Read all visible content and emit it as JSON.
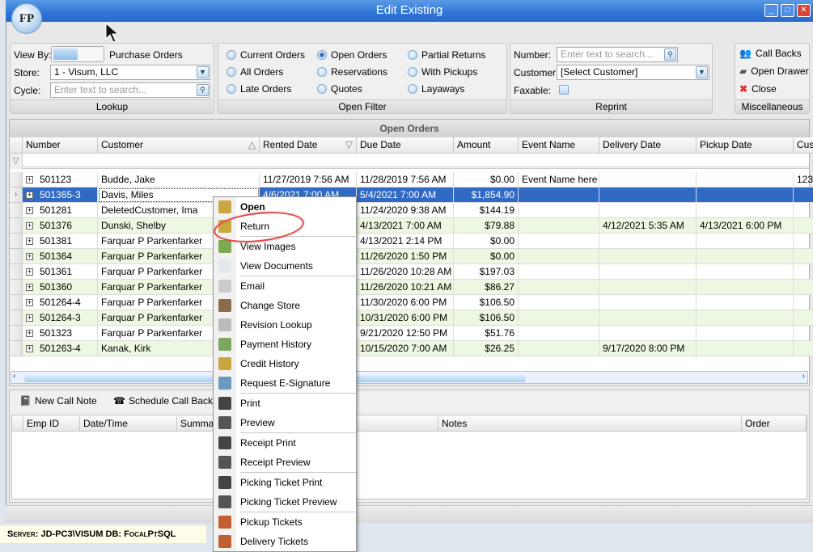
{
  "window": {
    "title": "Edit Existing",
    "logo": "FP"
  },
  "lookup": {
    "caption": "Lookup",
    "view_by_label": "View By:",
    "view_by_value": "Purchase Orders",
    "store_label": "Store:",
    "store_value": "1 - Visum, LLC",
    "cycle_label": "Cycle:",
    "cycle_placeholder": "Enter text to search..."
  },
  "open_filter": {
    "caption": "Open Filter",
    "options": [
      {
        "label": "Current Orders",
        "checked": false
      },
      {
        "label": "Open Orders",
        "checked": true
      },
      {
        "label": "Partial Returns",
        "checked": false
      },
      {
        "label": "All Orders",
        "checked": false
      },
      {
        "label": "Reservations",
        "checked": false
      },
      {
        "label": "With Pickups",
        "checked": false
      },
      {
        "label": "Late Orders",
        "checked": false
      },
      {
        "label": "Quotes",
        "checked": false
      },
      {
        "label": "Layaways",
        "checked": false
      }
    ]
  },
  "reprint": {
    "caption": "Reprint",
    "number_label": "Number:",
    "number_placeholder": "Enter text to search...",
    "customer_label": "Customer:",
    "customer_value": "[Select Customer]",
    "faxable_label": "Faxable:"
  },
  "misc": {
    "caption": "Miscellaneous",
    "call_backs": "Call Backs",
    "open_drawer": "Open Drawer",
    "close": "Close"
  },
  "grid": {
    "title": "Open Orders",
    "columns": [
      "Number",
      "Customer",
      "Rented Date",
      "Due Date",
      "Amount",
      "Event Name",
      "Delivery Date",
      "Pickup Date",
      "Cus"
    ],
    "rows": [
      [
        "501123",
        "Budde, Jake",
        "11/27/2019 7:56 AM",
        "11/28/2019 7:56 AM",
        "$0.00",
        "Event Name here",
        "",
        "",
        "123"
      ],
      [
        "501365-3",
        "Davis, Miles",
        "4/6/2021 7:00 AM",
        "5/4/2021 7:00 AM",
        "$1,854.90",
        "",
        "",
        "",
        ""
      ],
      [
        "501281",
        "DeletedCustomer, Ima",
        "",
        "11/24/2020 9:38 AM",
        "$144.19",
        "",
        "",
        "",
        ""
      ],
      [
        "501376",
        "Dunski, Shelby",
        "",
        "4/13/2021 7:00 AM",
        "$79.88",
        "",
        "4/12/2021 5:35 AM",
        "4/13/2021 6:00 PM",
        ""
      ],
      [
        "501381",
        "Farquar P Parkenfarker",
        "",
        "4/13/2021 2:14 PM",
        "$0.00",
        "",
        "",
        "",
        ""
      ],
      [
        "501364",
        "Farquar P Parkenfarker",
        "",
        "11/26/2020 1:50 PM",
        "$0.00",
        "",
        "",
        "",
        ""
      ],
      [
        "501361",
        "Farquar P Parkenfarker",
        "",
        "11/26/2020 10:28 AM",
        "$197.03",
        "",
        "",
        "",
        ""
      ],
      [
        "501360",
        "Farquar P Parkenfarker",
        "",
        "11/26/2020 10:21 AM",
        "$86.27",
        "",
        "",
        "",
        ""
      ],
      [
        "501264-4",
        "Farquar P Parkenfarker",
        "",
        "11/30/2020 6:00 PM",
        "$106.50",
        "",
        "",
        "",
        ""
      ],
      [
        "501264-3",
        "Farquar P Parkenfarker",
        "",
        "10/31/2020 6:00 PM",
        "$106.50",
        "",
        "",
        "",
        ""
      ],
      [
        "501323",
        "Farquar P Parkenfarker",
        "",
        "9/21/2020 12:50 PM",
        "$51.76",
        "",
        "",
        "",
        ""
      ],
      [
        "501263-4",
        "Kanak, Kirk",
        "",
        "10/15/2020 7:00 AM",
        "$26.25",
        "",
        "9/17/2020 8:00 PM",
        "",
        ""
      ]
    ],
    "selected_row": 1
  },
  "calls": {
    "new_call_note": "New Call Note",
    "schedule_call_back": "Schedule Call Back",
    "columns": [
      "Emp ID",
      "Date/Time",
      "Summary",
      "Notes",
      "Order"
    ]
  },
  "status": {
    "server": "Server: JD-PC3\\VISUM DB: FocalPtSQL"
  },
  "context_menu": {
    "items": [
      {
        "label": "Open",
        "bold": true,
        "icon": "open-order-icon"
      },
      {
        "label": "Return",
        "icon": "return-icon"
      },
      {
        "sep": true
      },
      {
        "label": "View Images",
        "icon": "image-icon"
      },
      {
        "label": "View Documents",
        "icon": "document-icon"
      },
      {
        "sep": true
      },
      {
        "label": "Email",
        "icon": "email-icon"
      },
      {
        "label": "Change Store",
        "icon": "store-icon"
      },
      {
        "label": "Revision Lookup",
        "icon": "revision-icon"
      },
      {
        "label": "Payment History",
        "icon": "payment-icon"
      },
      {
        "label": "Credit History",
        "icon": "credit-icon"
      },
      {
        "label": "Request E-Signature",
        "icon": "signature-icon"
      },
      {
        "sep": true
      },
      {
        "label": "Print",
        "icon": "printer-icon"
      },
      {
        "label": "Preview",
        "icon": "print-preview-icon"
      },
      {
        "sep": true
      },
      {
        "label": "Receipt Print",
        "icon": "printer-icon"
      },
      {
        "label": "Receipt Preview",
        "icon": "print-preview-icon"
      },
      {
        "sep": true
      },
      {
        "label": "Picking Ticket Print",
        "icon": "printer-icon"
      },
      {
        "label": "Picking Ticket Preview",
        "icon": "print-preview-icon"
      },
      {
        "sep": true
      },
      {
        "label": "Pickup Tickets",
        "icon": "truck-icon"
      },
      {
        "label": "Delivery Tickets",
        "icon": "truck-icon"
      }
    ]
  },
  "colors": {
    "title_bar": "#2e74d6",
    "selection": "#316ac5",
    "alt_row": "#eef7e2",
    "highlight_ring": "#e04848"
  }
}
